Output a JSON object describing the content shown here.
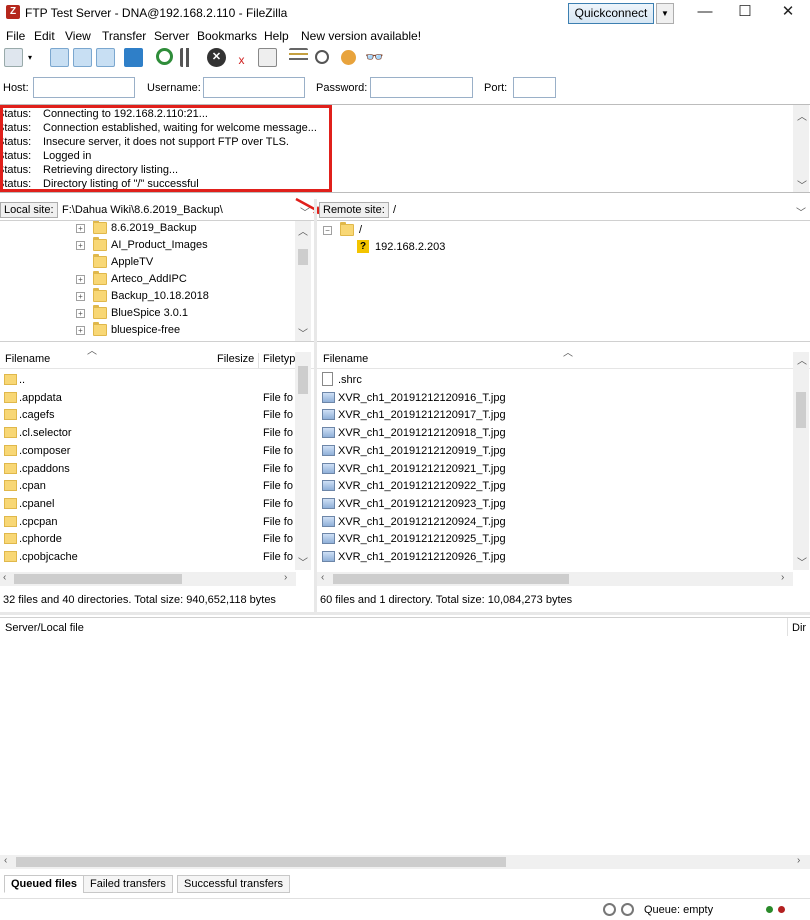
{
  "window": {
    "title": "FTP Test Server - DNA@192.168.2.110 - FileZilla",
    "controls": [
      "—",
      "☐",
      "✕"
    ]
  },
  "menu": [
    "File",
    "Edit",
    "View",
    "Transfer",
    "Server",
    "Bookmarks",
    "Help",
    "New version available!"
  ],
  "quickconnect": {
    "host_label": "Host:",
    "username_label": "Username:",
    "password_label": "Password:",
    "port_label": "Port:",
    "host_value": "",
    "username_value": "",
    "password_value": "",
    "port_value": "",
    "button_label": "Quickconnect"
  },
  "message_log": [
    {
      "status": "Status:",
      "text": "Connecting to 192.168.2.110:21..."
    },
    {
      "status": "Status:",
      "text": "Connection established, waiting for welcome message..."
    },
    {
      "status": "Status:",
      "text": "Insecure server, it does not support FTP over TLS."
    },
    {
      "status": "Status:",
      "text": "Logged in"
    },
    {
      "status": "Status:",
      "text": "Retrieving directory listing..."
    },
    {
      "status": "Status:",
      "text": "Directory listing of \"/\" successful"
    }
  ],
  "local": {
    "site_label": "Local site:",
    "site_path": "F:\\Dahua Wiki\\8.6.2019_Backup\\",
    "tree": [
      {
        "label": "8.6.2019_Backup",
        "expandable": true
      },
      {
        "label": "AI_Product_Images",
        "expandable": true
      },
      {
        "label": "AppleTV",
        "expandable": false
      },
      {
        "label": "Arteco_AddIPC",
        "expandable": true
      },
      {
        "label": "Backup_10.18.2018",
        "expandable": true
      },
      {
        "label": "BlueSpice 3.0.1",
        "expandable": true
      },
      {
        "label": "bluespice-free",
        "expandable": true
      }
    ],
    "columns": [
      "Filename",
      "Filesize",
      "Filetyp"
    ],
    "files": [
      {
        "name": "..",
        "type": ""
      },
      {
        "name": ".appdata",
        "type": "File fo"
      },
      {
        "name": ".cagefs",
        "type": "File fo"
      },
      {
        "name": ".cl.selector",
        "type": "File fo"
      },
      {
        "name": ".composer",
        "type": "File fo"
      },
      {
        "name": ".cpaddons",
        "type": "File fo"
      },
      {
        "name": ".cpan",
        "type": "File fo"
      },
      {
        "name": ".cpanel",
        "type": "File fo"
      },
      {
        "name": ".cpcpan",
        "type": "File fo"
      },
      {
        "name": ".cphorde",
        "type": "File fo"
      },
      {
        "name": ".cpobjcache",
        "type": "File fo"
      }
    ],
    "summary": "32 files and 40 directories. Total size: 940,652,118 bytes"
  },
  "remote": {
    "site_label": "Remote site:",
    "site_path": "/",
    "tree": [
      {
        "label": "/",
        "level": 0
      },
      {
        "label": "192.168.2.203",
        "level": 1
      }
    ],
    "columns": [
      "Filename"
    ],
    "files": [
      {
        "name": ".shrc",
        "kind": "file"
      },
      {
        "name": "XVR_ch1_20191212120916_T.jpg",
        "kind": "image"
      },
      {
        "name": "XVR_ch1_20191212120917_T.jpg",
        "kind": "image"
      },
      {
        "name": "XVR_ch1_20191212120918_T.jpg",
        "kind": "image"
      },
      {
        "name": "XVR_ch1_20191212120919_T.jpg",
        "kind": "image"
      },
      {
        "name": "XVR_ch1_20191212120921_T.jpg",
        "kind": "image"
      },
      {
        "name": "XVR_ch1_20191212120922_T.jpg",
        "kind": "image"
      },
      {
        "name": "XVR_ch1_20191212120923_T.jpg",
        "kind": "image"
      },
      {
        "name": "XVR_ch1_20191212120924_T.jpg",
        "kind": "image"
      },
      {
        "name": "XVR_ch1_20191212120925_T.jpg",
        "kind": "image"
      },
      {
        "name": "XVR_ch1_20191212120926_T.jpg",
        "kind": "image"
      }
    ],
    "summary": "60 files and 1 directory. Total size: 10,084,273 bytes"
  },
  "queue": {
    "columns": [
      "Server/Local file",
      "Dir"
    ],
    "tabs": [
      "Queued files",
      "Failed transfers",
      "Successful transfers"
    ],
    "status": "Queue: empty"
  },
  "colors": {
    "highlight_box": "#e0201b",
    "folder": "#f8d775",
    "accent": "#3c7fb1"
  }
}
